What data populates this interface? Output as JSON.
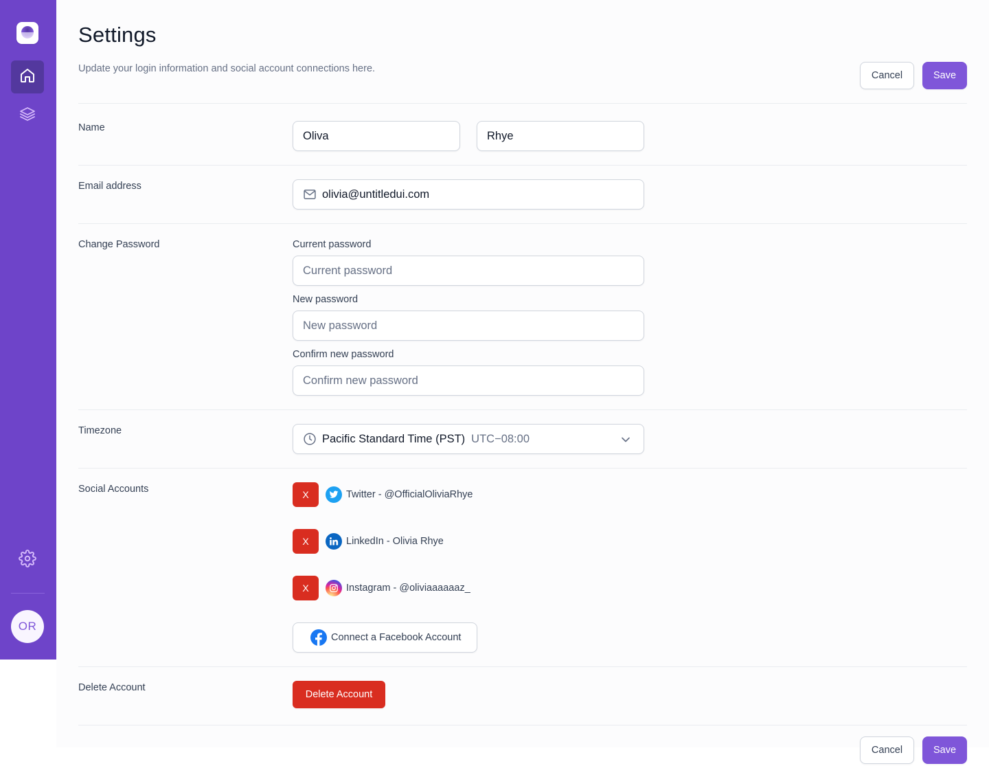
{
  "sidebar": {
    "avatar_initials": "OR",
    "accent_color": "#6e44c9",
    "active_color": "#53389e",
    "nav": [
      {
        "icon": "home-icon",
        "active": true
      },
      {
        "icon": "layers-icon",
        "active": false
      }
    ],
    "bottom_icon": "settings-icon"
  },
  "header": {
    "title": "Settings",
    "subtitle": "Update your login information and social account connections here.",
    "cancel_label": "Cancel",
    "save_label": "Save"
  },
  "form": {
    "name": {
      "label": "Name",
      "first_name": "Oliva",
      "last_name": "Rhye"
    },
    "email": {
      "label": "Email address",
      "value": "olivia@untitledui.com",
      "icon": "mail-icon"
    },
    "password": {
      "label": "Change Password",
      "current_label": "Current password",
      "current_placeholder": "Current password",
      "new_label": "New password",
      "new_placeholder": "New password",
      "confirm_label": "Confirm new password",
      "confirm_placeholder": "Confirm new password"
    },
    "timezone": {
      "label": "Timezone",
      "value": "Pacific Standard Time (PST)",
      "offset": "UTC−08:00",
      "icon": "clock-icon"
    },
    "social": {
      "label": "Social Accounts",
      "remove_label": "X",
      "accounts": [
        {
          "icon": "twitter-icon",
          "text": "Twitter - @OfficialOliviaRhye",
          "color": "#1da1f2"
        },
        {
          "icon": "linkedin-icon",
          "text": "LinkedIn - Olivia Rhye",
          "color": "#0a66c2"
        },
        {
          "icon": "instagram-icon",
          "text": "Instagram - @oliviaaaaaaz_",
          "color": "#e4405f"
        }
      ],
      "connect_facebook_label": "Connect a Facebook Account"
    },
    "delete": {
      "label": "Delete Account",
      "button_label": "Delete Account",
      "color": "#d92d20"
    }
  },
  "footer": {
    "cancel_label": "Cancel",
    "save_label": "Save"
  }
}
